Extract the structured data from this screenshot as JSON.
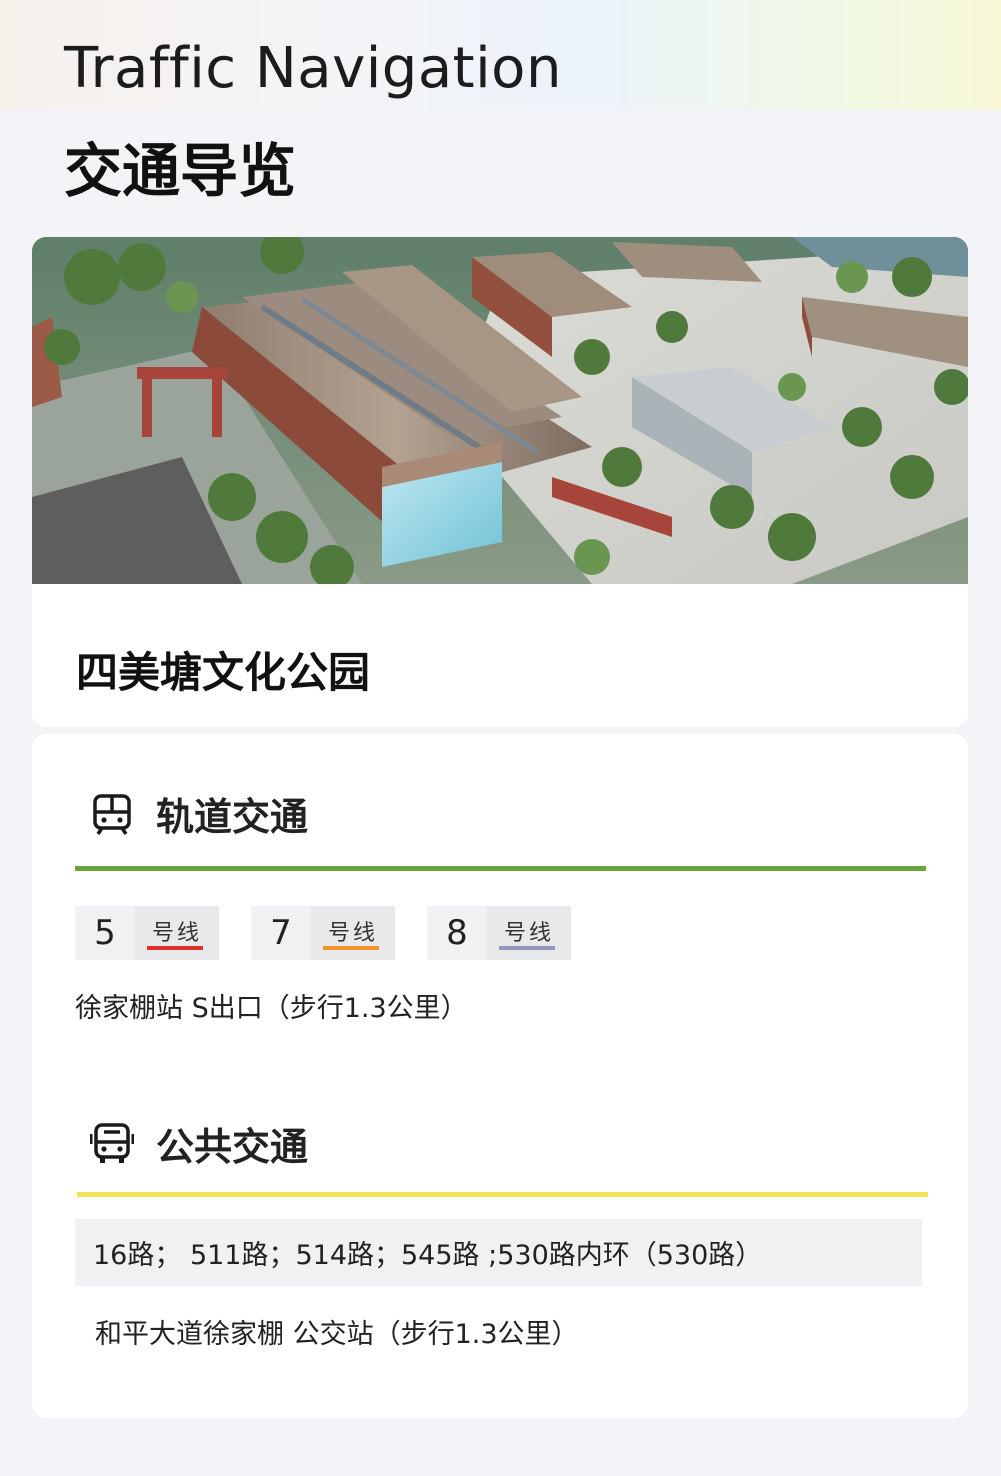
{
  "header": {
    "title_en": "Traffic Navigation",
    "title_cn": "交通导览"
  },
  "venue": {
    "name": "四美塘文化公园"
  },
  "rail": {
    "section_title": "轨道交通",
    "section_icon": "train-icon",
    "rule_color": "#6aa33a",
    "lines": [
      {
        "number": "5",
        "label": "号线",
        "color": "#e0302a"
      },
      {
        "number": "7",
        "label": "号线",
        "color": "#f2942a"
      },
      {
        "number": "8",
        "label": "号线",
        "color": "#8f98b8"
      }
    ],
    "station": "徐家棚站  S出口（步行1.3公里）"
  },
  "bus": {
    "section_title": "公共交通",
    "section_icon": "bus-icon",
    "rule_color": "#f2e25a",
    "routes": "16路； 511路；514路；545路 ;530路内环（530路）",
    "station": "和平大道徐家棚 公交站（步行1.3公里）"
  }
}
